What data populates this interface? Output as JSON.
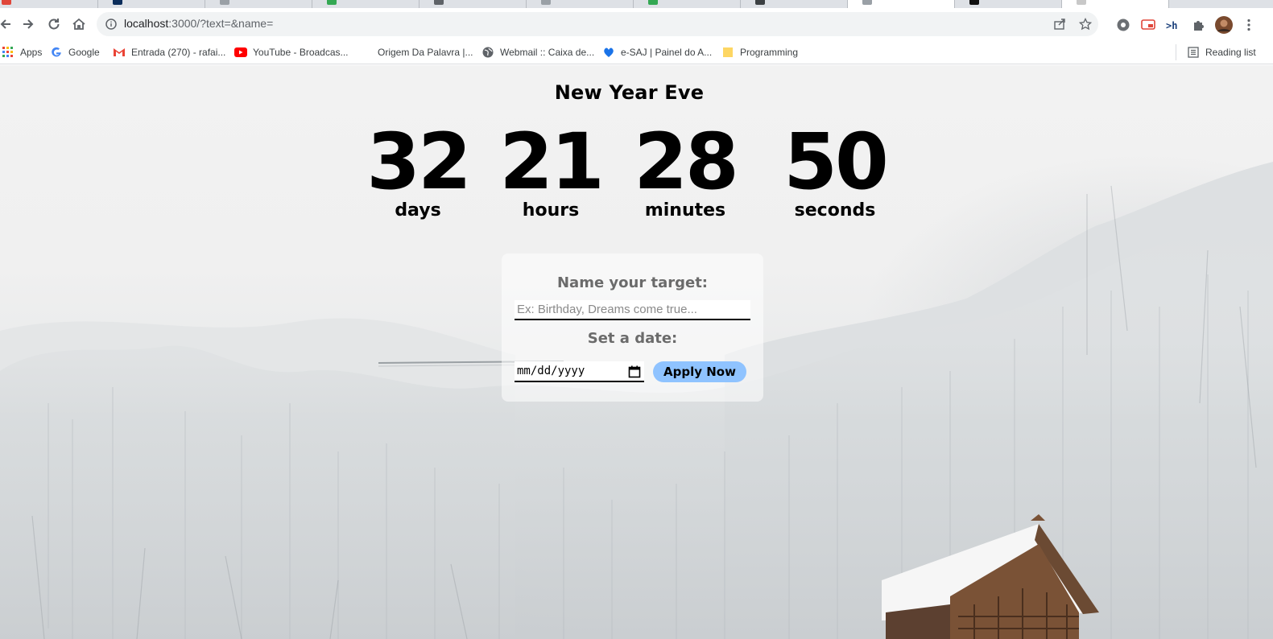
{
  "browser": {
    "url_host": "localhost",
    "url_rest": ":3000/?text=&name=",
    "bookmarks": [
      {
        "label": "Apps",
        "icon": "apps-grid-icon"
      },
      {
        "label": "Google",
        "icon": "google-icon"
      },
      {
        "label": "Entrada (270) - rafai...",
        "icon": "gmail-icon"
      },
      {
        "label": "YouTube - Broadcas...",
        "icon": "youtube-icon"
      },
      {
        "label": "Origem Da Palavra |...",
        "icon": "blank-icon"
      },
      {
        "label": "Webmail :: Caixa de...",
        "icon": "globe-icon"
      },
      {
        "label": "e-SAJ | Painel do A...",
        "icon": "esaj-icon"
      },
      {
        "label": "Programming",
        "icon": "folder-icon"
      }
    ],
    "reading_list": "Reading list",
    "colors": {
      "chrome_bg": "#dee1e6",
      "omnibox_bg": "#f1f3f4",
      "accent": "#1a73e8"
    }
  },
  "countdown": {
    "title": "New Year Eve",
    "units": [
      {
        "value": "32",
        "label": "days"
      },
      {
        "value": "21",
        "label": "hours"
      },
      {
        "value": "28",
        "label": "minutes"
      },
      {
        "value": "50",
        "label": "seconds"
      }
    ]
  },
  "form": {
    "name_heading": "Name your target:",
    "name_placeholder": "Ex: Birthday, Dreams come true...",
    "name_value": "",
    "date_heading": "Set a date:",
    "date_placeholder": "mm/dd/yyyy",
    "apply_label": "Apply Now",
    "apply_color": "#8fc3ff"
  }
}
